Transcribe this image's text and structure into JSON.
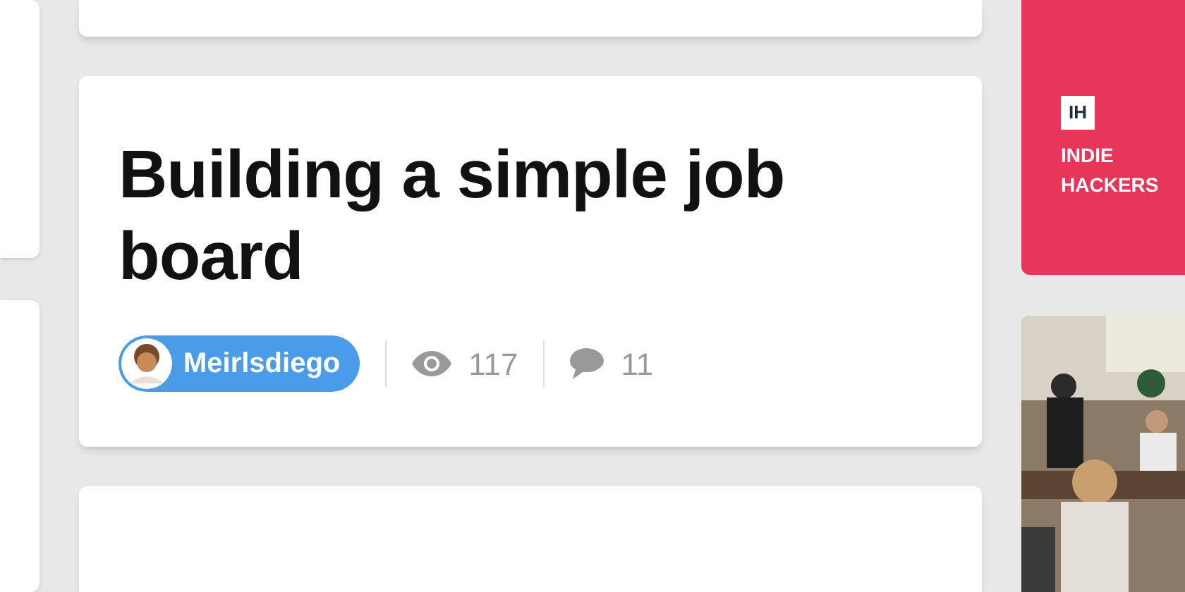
{
  "post": {
    "title": "Building a simple job board",
    "author": "Meirlsdiego",
    "views": "117",
    "comments": "11"
  },
  "sponsor": {
    "logo": "IH",
    "name": "INDIE HACKERS"
  }
}
